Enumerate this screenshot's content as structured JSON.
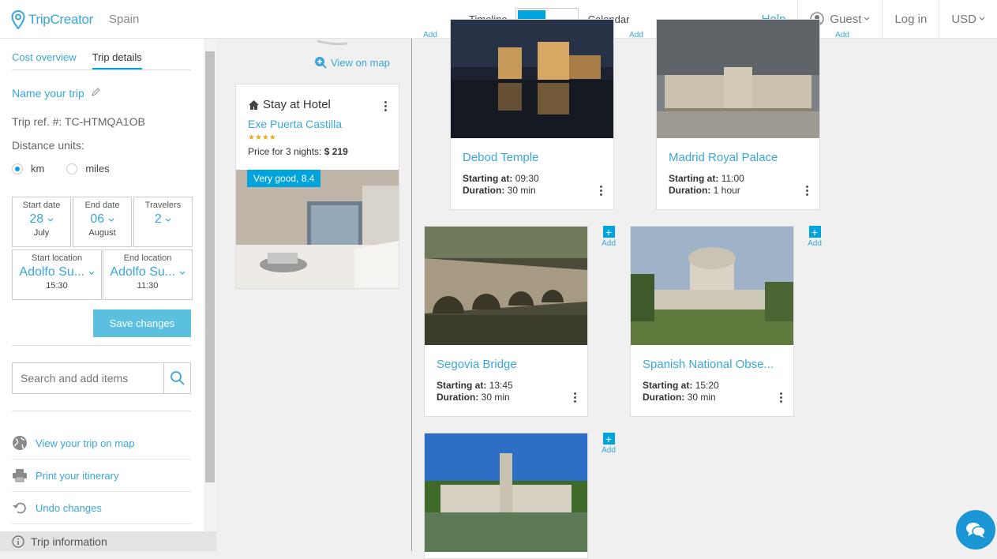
{
  "header": {
    "brand": "TripCreator",
    "country": "Spain",
    "toggle_left": "Timeline",
    "toggle_right": "Calendar",
    "help": "Help",
    "user": "Guest",
    "login": "Log in",
    "currency": "USD"
  },
  "sidebar": {
    "tabs": [
      "Cost overview",
      "Trip details"
    ],
    "trip_name_label": "Name your trip",
    "trip_ref": "Trip ref. #: TC-HTMQA1OB",
    "distance_units": "Distance units:",
    "unit_km": "km",
    "unit_miles": "miles",
    "start_date": {
      "label": "Start date",
      "value": "28",
      "sub": "July"
    },
    "end_date": {
      "label": "End date",
      "value": "06",
      "sub": "August"
    },
    "travelers": {
      "label": "Travelers",
      "value": "2"
    },
    "start_location": {
      "label": "Start location",
      "value": "Adolfo Su...",
      "sub": "15:30"
    },
    "end_location": {
      "label": "End location",
      "value": "Adolfo Su...",
      "sub": "11:30"
    },
    "save_label": "Save changes",
    "search_placeholder": "Search and add items",
    "links": [
      "View your trip on map",
      "Print your itinerary",
      "Undo changes"
    ],
    "trip_info": "Trip information"
  },
  "main": {
    "view_on_map": "View on map",
    "hotel": {
      "title": "Stay at Hotel",
      "name": "Exe Puerta Castilla",
      "stars": "★★★★",
      "price_label": "Price for 3 nights:",
      "price": "$ 219",
      "rating": "Very good, 8.4"
    },
    "add_label": "Add",
    "start_label": "Starting at:",
    "duration_label": "Duration:",
    "activities": [
      {
        "name": "Debod Temple",
        "start": "09:30",
        "duration": "30 min"
      },
      {
        "name": "Madrid Royal Palace",
        "start": "11:00",
        "duration": "1 hour"
      },
      {
        "name": "Segovia Bridge",
        "start": "13:45",
        "duration": "30 min"
      },
      {
        "name": "Spanish National Obse...",
        "start": "15:20",
        "duration": "30 min"
      },
      {
        "name": "",
        "start": "",
        "duration": ""
      }
    ]
  },
  "colors": {
    "accent": "#00a4dc",
    "link": "#3aa6d8",
    "button": "#5bc0de",
    "stars": "#e8a923"
  }
}
